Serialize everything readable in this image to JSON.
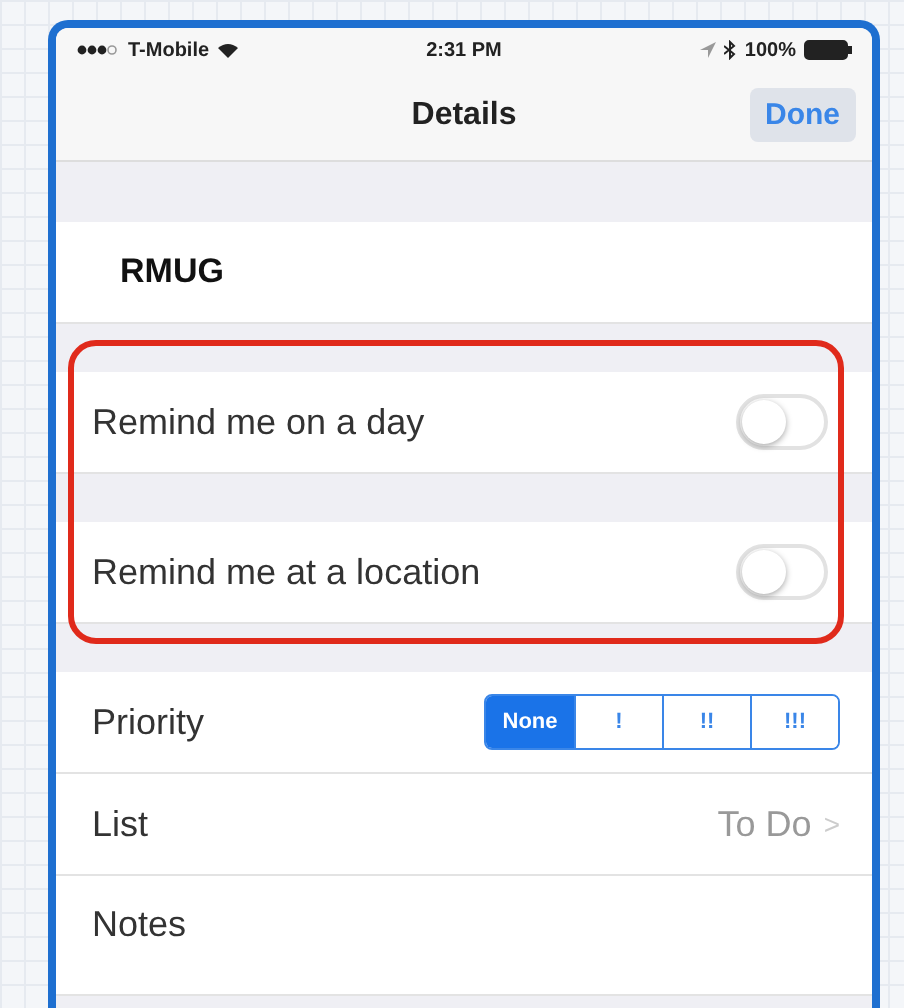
{
  "status_bar": {
    "carrier": "T-Mobile",
    "time": "2:31 PM",
    "battery": "100%"
  },
  "nav": {
    "title": "Details",
    "done": "Done"
  },
  "title": "RMUG",
  "reminders": [
    {
      "label": "Remind me on a day",
      "on": false
    },
    {
      "label": "Remind me at a location",
      "on": false
    }
  ],
  "priority": {
    "label": "Priority",
    "options": [
      {
        "label": "None",
        "selected": true
      },
      {
        "label": "!",
        "selected": false
      },
      {
        "label": "!!",
        "selected": false
      },
      {
        "label": "!!!",
        "selected": false
      }
    ]
  },
  "list": {
    "label": "List",
    "value": "To Do",
    "chevron": ">"
  },
  "notes": {
    "label": "Notes"
  }
}
